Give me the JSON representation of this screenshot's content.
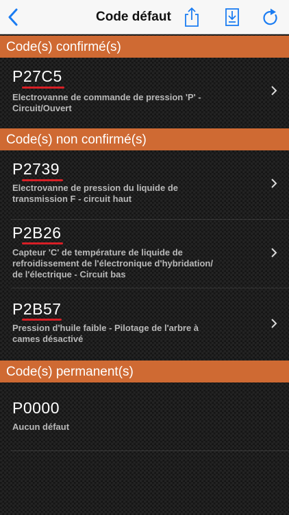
{
  "navbar": {
    "title": "Code défaut",
    "back_icon": "chevron-left-icon",
    "share_icon": "share-icon",
    "save_icon": "save-download-icon",
    "refresh_icon": "refresh-icon",
    "accent": "#1a7cf2"
  },
  "colors": {
    "section_header": "#cf6a33",
    "underline": "#d81f26",
    "description": "#b9b9b9"
  },
  "sections": {
    "confirmed": {
      "title": "Code(s) confirmé(s)",
      "items": [
        {
          "code": "P27C5",
          "desc_lines": [
            "Electrovanne de commande de pression 'P' -",
            "Circuit/Ouvert"
          ]
        }
      ]
    },
    "non_confirmed": {
      "title": "Code(s) non confirmé(s)",
      "items": [
        {
          "code": "P2739",
          "desc_lines": [
            "Electrovanne de pression du liquide de",
            "transmission F - circuit haut"
          ]
        },
        {
          "code": "P2B26",
          "desc_lines": [
            "Capteur 'C' de température de liquide de",
            "refroidissement de l'électronique d'hybridation/",
            "de l'électrique - Circuit bas"
          ]
        },
        {
          "code": "P2B57",
          "desc_lines": [
            "Pression d'huile faible - Pilotage de l'arbre à",
            "cames désactivé"
          ]
        }
      ]
    },
    "permanent": {
      "title": "Code(s) permanent(s)",
      "items": [
        {
          "code": "P0000",
          "desc_lines": [
            "Aucun défaut"
          ]
        }
      ]
    }
  }
}
